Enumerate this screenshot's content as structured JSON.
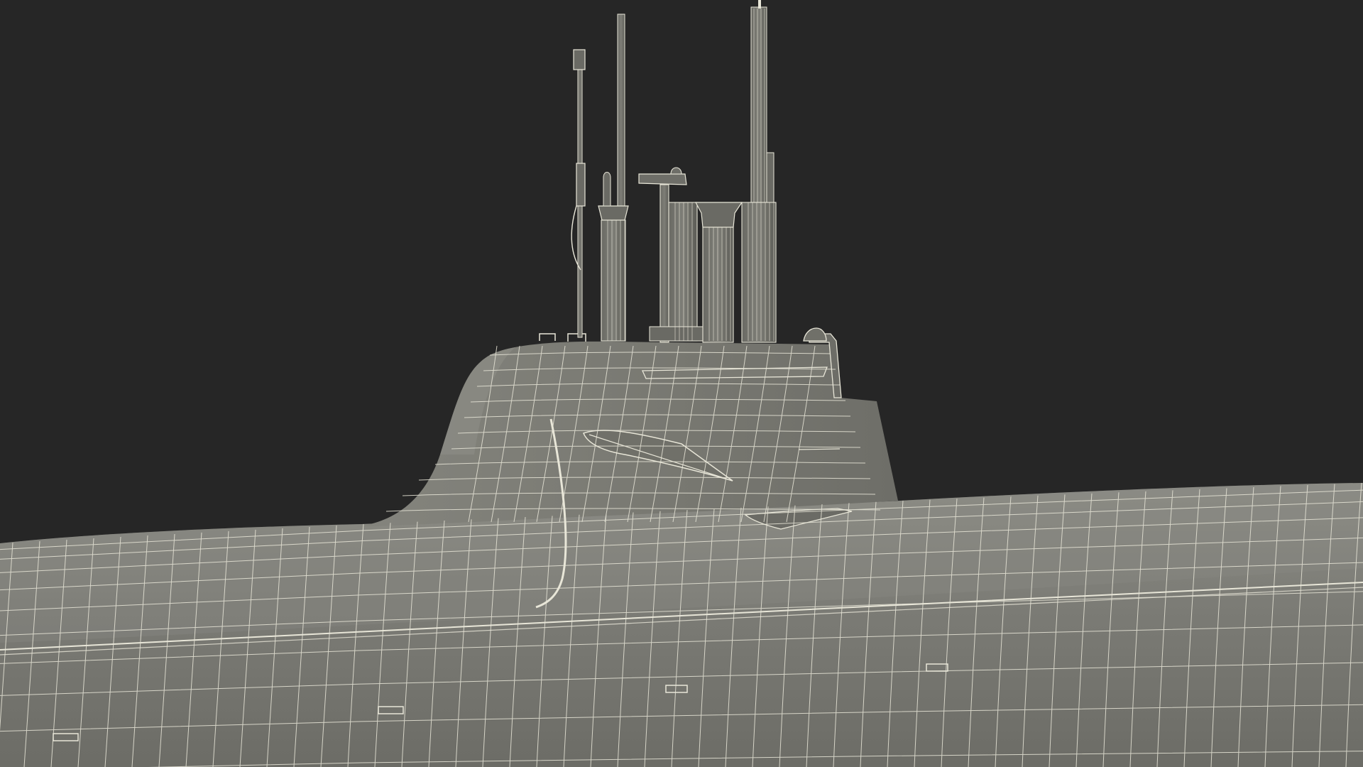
{
  "scene": {
    "subject": "submarine-wireframe-render",
    "colors": {
      "background": "#262626",
      "hull_fill": "#7a7a74",
      "hull_fill_light": "#8a8a84",
      "hull_fill_dark": "#66665f",
      "wire": "#e8e6d8",
      "mast_fill": "#5e5e58",
      "shadow": "#55554f"
    }
  }
}
